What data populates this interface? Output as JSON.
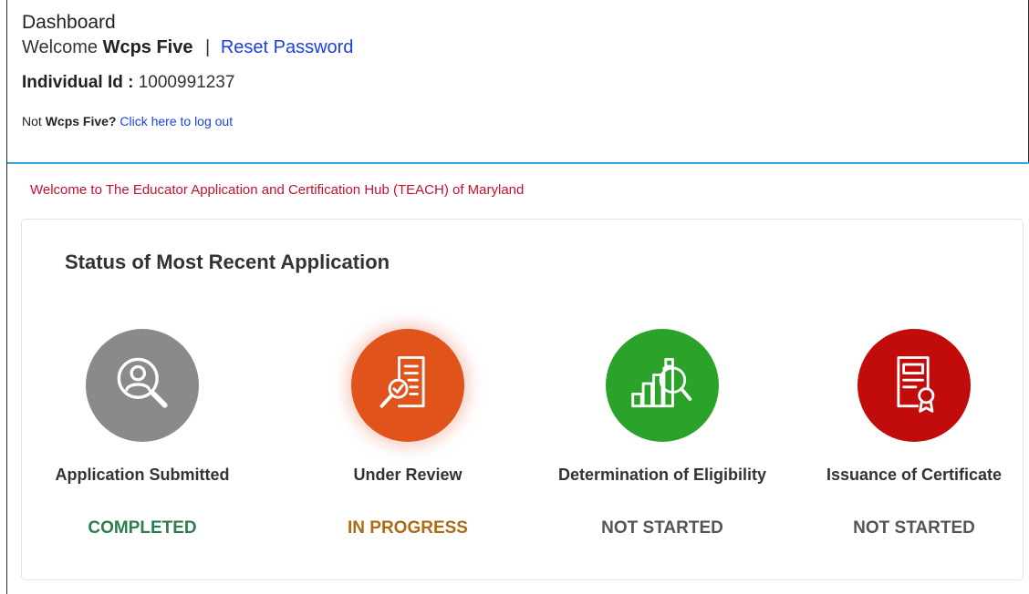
{
  "header": {
    "title": "Dashboard",
    "welcome_prefix": "Welcome",
    "user_name": "Wcps Five",
    "separator": "|",
    "reset_password": "Reset Password",
    "individual_id_label": "Individual Id :",
    "individual_id_value": "1000991237",
    "not_prefix": "Not",
    "not_user": "Wcps Five?",
    "logout_link": "Click here to log out"
  },
  "banner": {
    "text": "Welcome to The Educator Application and Certification Hub (TEACH) of Maryland"
  },
  "status_card": {
    "title": "Status of Most Recent Application",
    "steps": [
      {
        "label": "Application Submitted",
        "status": "COMPLETED",
        "icon": "search-user-icon",
        "circle_color": "#8a8a8a",
        "status_color": "#2e7d4f"
      },
      {
        "label": "Under Review",
        "status": "IN PROGRESS",
        "icon": "document-review-icon",
        "circle_color": "#e0531b",
        "status_color": "#b06a14"
      },
      {
        "label": "Determination of Eligibility",
        "status": "NOT STARTED",
        "icon": "chart-magnifier-icon",
        "circle_color": "#2ba32b",
        "status_color": "#555555"
      },
      {
        "label": "Issuance of Certificate",
        "status": "NOT STARTED",
        "icon": "certificate-icon",
        "circle_color": "#c20b0b",
        "status_color": "#555555"
      }
    ]
  },
  "colors": {
    "link": "#1a3ee8",
    "banner_text": "#c8102e",
    "divider": "#33a6de"
  }
}
